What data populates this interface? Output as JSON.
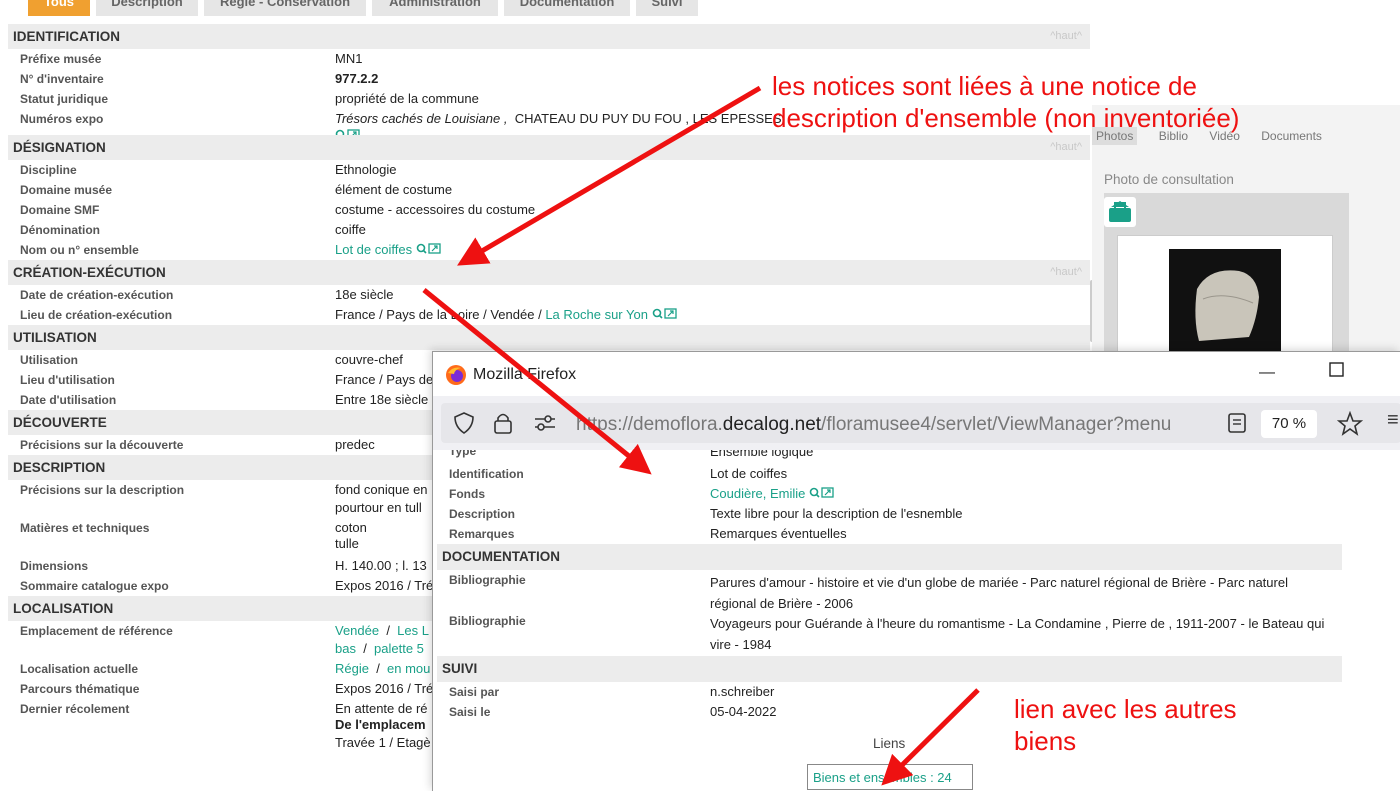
{
  "tabs": [
    "Tous",
    "Description",
    "Régie - Conservation",
    "Administration",
    "Documentation",
    "Suivi"
  ],
  "haut_label": "^haut^",
  "sections": {
    "identification": "IDENTIFICATION",
    "designation": "DÉSIGNATION",
    "creation": "CRÉATION-EXÉCUTION",
    "utilisation": "UTILISATION",
    "decouverte": "DÉCOUVERTE",
    "description": "DESCRIPTION",
    "localisation": "LOCALISATION"
  },
  "fields": {
    "prefixe_label": "Préfixe musée",
    "prefixe": "MN1",
    "inventaire_label": "N° d'inventaire",
    "inventaire": "977.2.2",
    "statut_label": "Statut juridique",
    "statut": "propriété de la commune",
    "expo_label": "Numéros expo",
    "expo_title": "Trésors cachés de Louisiane ,",
    "expo_place": "CHATEAU DU PUY DU FOU , LES EPESSES",
    "discipline_label": "Discipline",
    "discipline": "Ethnologie",
    "domaine_label": "Domaine musée",
    "domaine": "élément de costume",
    "smf_label": "Domaine SMF",
    "smf": "costume - accessoires du costume",
    "denomination_label": "Dénomination",
    "denomination": "coiffe",
    "ensemble_label": "Nom ou n° ensemble",
    "ensemble": "Lot de coiffes",
    "date_crea_label": "Date de création-exécution",
    "date_crea": "18e siècle",
    "lieu_crea_label": "Lieu de création-exécution",
    "lieu_crea": "France / Pays de la Loire / Vendée /",
    "lieu_crea_link": "La Roche sur Yon",
    "utilisation_label": "Utilisation",
    "utilisation": "couvre-chef",
    "lieu_util_label": "Lieu d'utilisation",
    "lieu_util": "France / Pays de",
    "date_util_label": "Date d'utilisation",
    "date_util": "Entre 18e siècle",
    "decouverte_label": "Précisions sur la découverte",
    "decouverte": "predec",
    "desc_label": "Précisions sur la description",
    "desc_1": "fond conique en",
    "desc_2": "pourtour en tull",
    "matieres_label": "Matières et techniques",
    "matieres_1": "coton",
    "matieres_2": "tulle",
    "dimensions_label": "Dimensions",
    "dimensions": "H. 140.00 ; l. 13",
    "sommaire_label": "Sommaire catalogue expo",
    "sommaire": "Expos 2016 / Tré",
    "emplacement_label": "Emplacement de référence",
    "emplacement_1a": "Vendée",
    "emplacement_1b": "Les L",
    "emplacement_2a": "bas",
    "emplacement_2b": "palette 5",
    "loc_actuelle_label": "Localisation actuelle",
    "loc_actuelle_a": "Régie",
    "loc_actuelle_b": "en mou",
    "parcours_label": "Parcours thématique",
    "parcours": "Expos 2016 / Tré",
    "recolement_label": "Dernier récolement",
    "recolement_1": "En attente de ré",
    "recolement_2": "De l'emplacem",
    "recolement_3": "Travée 1 / Etagè"
  },
  "right_panel": {
    "tabs": [
      "Photos",
      "Biblio",
      "Vidéo",
      "Documents"
    ],
    "photo_label": "Photo de consultation"
  },
  "firefox": {
    "title": "Mozilla Firefox",
    "url_prefix": "https://demoflora.",
    "url_domain": "decalog.net",
    "url_suffix": "/floramusee4/servlet/ViewManager?menu",
    "zoom": "70 %",
    "top_label": "Type",
    "top_value": "Ensemble logique",
    "rows": [
      {
        "label": "Identification",
        "value": "Lot de coiffes"
      },
      {
        "label": "Fonds",
        "value": "Coudière, Emilie"
      },
      {
        "label": "Description",
        "value": "Texte libre pour la description de l'esnemble"
      },
      {
        "label": "Remarques",
        "value": "Remarques éventuelles"
      }
    ],
    "documentation": "DOCUMENTATION",
    "biblio": [
      {
        "label": "Bibliographie",
        "value": "Parures d'amour - histoire et vie d'un globe de mariée - Parc naturel régional de Brière - Parc naturel régional de Brière - 2006"
      },
      {
        "label": "Bibliographie",
        "value": "Voyageurs pour Guérande à l'heure du romantisme - La Condamine , Pierre de , 1911-2007 - le Bateau qui vire - 1984"
      }
    ],
    "suivi": "SUIVI",
    "saisi_par_label": "Saisi par",
    "saisi_par": "n.schreiber",
    "saisi_le_label": "Saisi le",
    "saisi_le": "05-04-2022",
    "liens": "Liens",
    "biens": "Biens et ensembles : 24"
  },
  "annotations": {
    "top_1": "les notices sont liées à une notice de",
    "top_2": "description d'ensemble (non inventoriée)",
    "bottom_1": "lien avec les autres",
    "bottom_2": "biens"
  },
  "colors": {
    "accent": "#1aa088",
    "annotation": "#ee1111",
    "tab_active": "#f0a030"
  }
}
